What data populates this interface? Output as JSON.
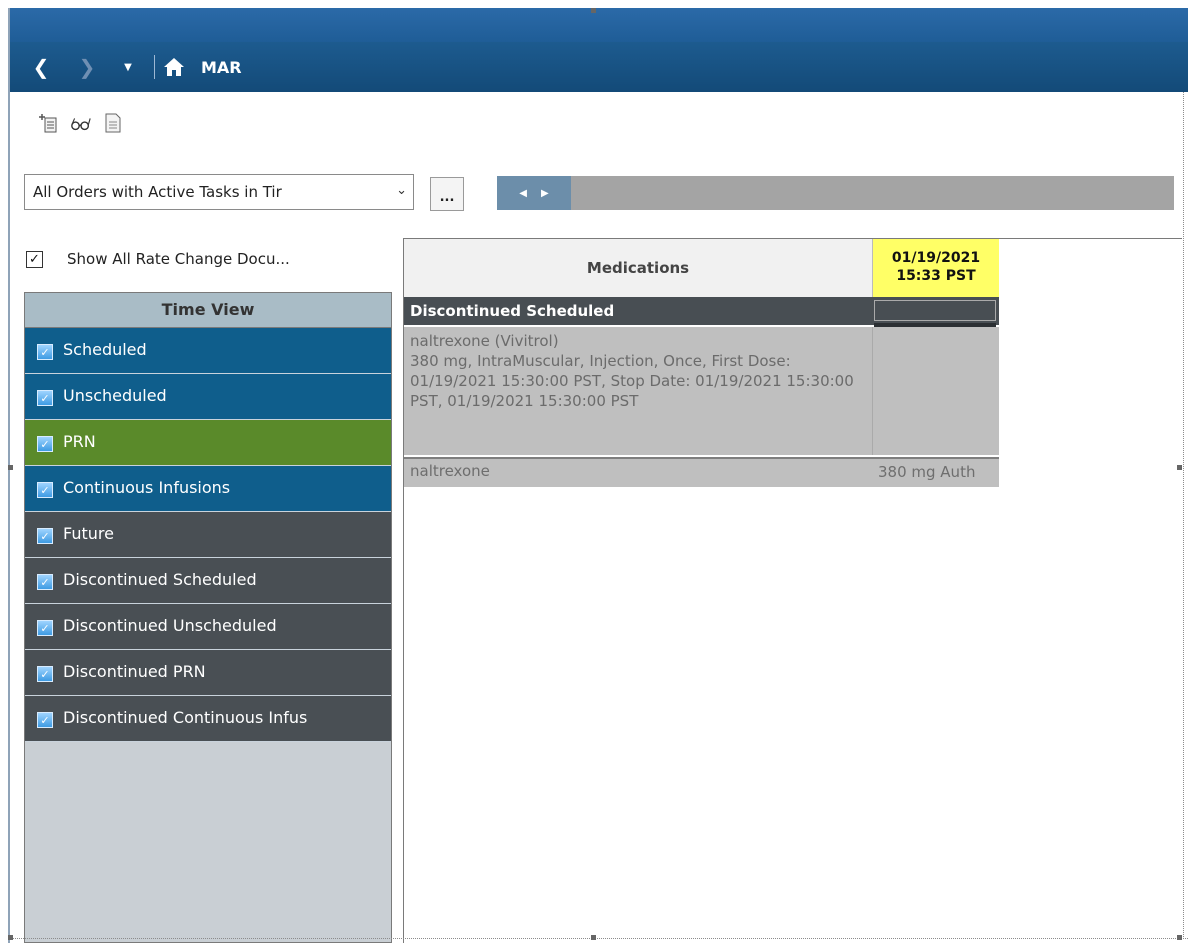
{
  "nav": {
    "back_icon": "chevron-left-icon",
    "forward_icon": "chevron-right-icon",
    "dropdown_icon": "caret-down-icon",
    "home_icon": "home-icon",
    "title": "MAR"
  },
  "toolbar": {
    "icons": [
      "add-document-icon",
      "glasses-icon",
      "document-icon"
    ]
  },
  "filter": {
    "selected": "All Orders with Active Tasks in Tir",
    "ellipsis_label": "..."
  },
  "show_all_rate_change": {
    "checked": true,
    "label": "Show All Rate Change Docu..."
  },
  "time_view": {
    "header": "Time View",
    "items": [
      {
        "label": "Scheduled",
        "checked": true,
        "color": "#0f5e8c"
      },
      {
        "label": "Unscheduled",
        "checked": true,
        "color": "#0f5e8c"
      },
      {
        "label": "PRN",
        "checked": true,
        "color": "#5a8a2a"
      },
      {
        "label": "Continuous Infusions",
        "checked": true,
        "color": "#0f5e8c"
      },
      {
        "label": "Future",
        "checked": true,
        "color": "#494f54"
      },
      {
        "label": "Discontinued Scheduled",
        "checked": true,
        "color": "#494f54"
      },
      {
        "label": "Discontinued Unscheduled",
        "checked": true,
        "color": "#494f54"
      },
      {
        "label": "Discontinued PRN",
        "checked": true,
        "color": "#494f54"
      },
      {
        "label": "Discontinued Continuous Infus",
        "checked": true,
        "color": "#494f54"
      }
    ]
  },
  "grid": {
    "medications_header": "Medications",
    "date_header_line1": "01/19/2021",
    "date_header_line2": "15:33 PST",
    "group_title": "Discontinued Scheduled",
    "order": {
      "name": "naltrexone (Vivitrol)",
      "details": "380 mg, IntraMuscular, Injection, Once, First Dose: 01/19/2021 15:30:00 PST, Stop Date: 01/19/2021 15:30:00 PST, 01/19/2021 15:30:00 PST"
    },
    "task": {
      "name": "naltrexone",
      "value": "380 mg Auth"
    }
  }
}
